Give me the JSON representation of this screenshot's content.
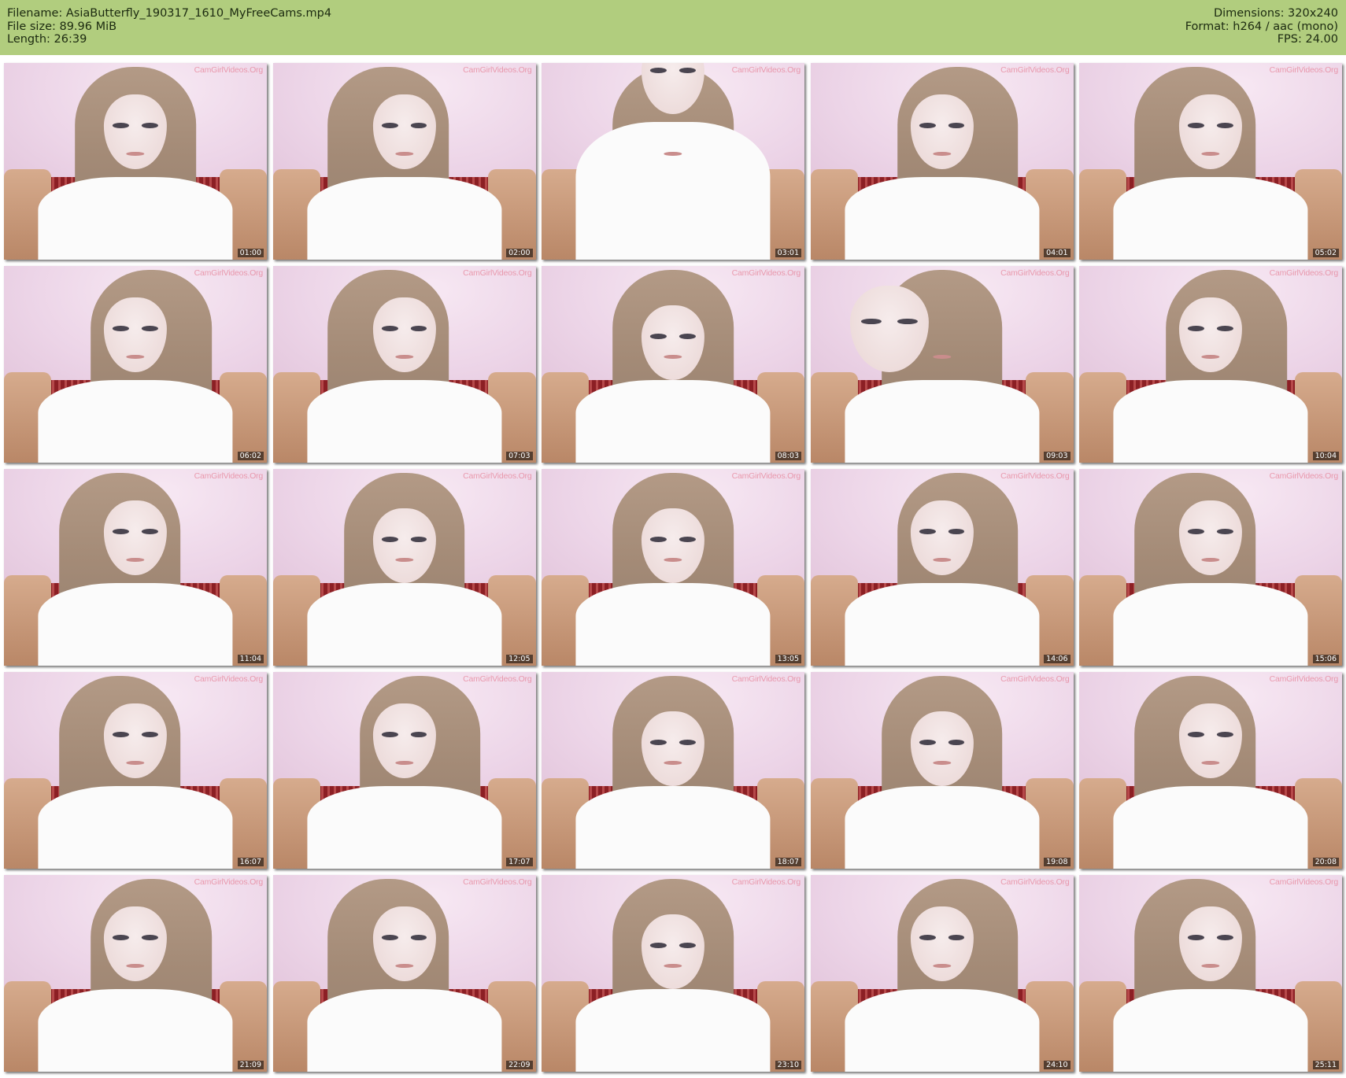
{
  "header": {
    "background": "#b1cd7e",
    "left": [
      "Filename: AsiaButterfly_190317_1610_MyFreeCams.mp4",
      "File size: 89.96 MiB",
      "Length: 26:39"
    ],
    "right": [
      "Dimensions: 320x240",
      "Format: h264 / aac (mono)",
      "FPS: 24.00"
    ]
  },
  "watermark": "CamGirlVideos.Org",
  "thumbnails": [
    {
      "time": "01:00"
    },
    {
      "time": "02:00"
    },
    {
      "time": "03:01"
    },
    {
      "time": "04:01"
    },
    {
      "time": "05:02"
    },
    {
      "time": "06:02"
    },
    {
      "time": "07:03"
    },
    {
      "time": "08:03"
    },
    {
      "time": "09:03"
    },
    {
      "time": "10:04"
    },
    {
      "time": "11:04"
    },
    {
      "time": "12:05"
    },
    {
      "time": "13:05"
    },
    {
      "time": "14:06"
    },
    {
      "time": "15:06"
    },
    {
      "time": "16:07"
    },
    {
      "time": "17:07"
    },
    {
      "time": "18:07"
    },
    {
      "time": "19:08"
    },
    {
      "time": "20:08"
    },
    {
      "time": "21:09"
    },
    {
      "time": "22:09"
    },
    {
      "time": "23:10"
    },
    {
      "time": "24:10"
    },
    {
      "time": "25:11"
    }
  ]
}
